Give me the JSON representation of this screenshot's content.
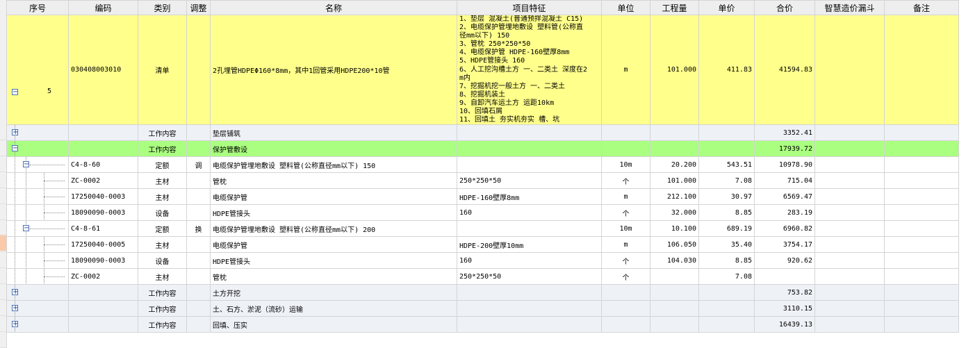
{
  "columns": {
    "seq": "序号",
    "code": "编码",
    "type": "类别",
    "adjust": "调整",
    "name": "名称",
    "features": "项目特征",
    "unit": "单位",
    "qty": "工程量",
    "price": "单价",
    "total": "合价",
    "smart": "智慧造价漏斗",
    "note": "备注"
  },
  "bill": {
    "seq": "5",
    "code": "030408003010",
    "type": "清单",
    "name": "2孔埋管HDPEΦ160*8mm，其中1回管采用HDPE200*10管",
    "features": [
      "1、垫层 混凝土(普通预拌混凝土 C15)",
      "2、电缆保护管埋地敷设 塑料管(公称直",
      "径mm以下) 150",
      "3、管枕 250*250*50",
      "4、电缆保护管 HDPE-160壁厚8mm",
      "5、HDPE管接头 160",
      "6、人工挖沟槽土方 一、二类土 深度在2",
      "m内",
      "7、挖掘机挖一般土方 一、二类土",
      "8、挖掘机装土",
      "9、自卸汽车运土方 运距10km",
      "10、回填石屑",
      "11、回填土 夯实机夯实 槽、坑"
    ],
    "unit": "m",
    "qty": "101.000",
    "price": "411.83",
    "total": "41594.83"
  },
  "rows": [
    {
      "kind": "gz",
      "code": "",
      "type": "工作内容",
      "adjust": "",
      "name": "垫层铺筑",
      "features": "",
      "unit": "",
      "qty": "",
      "price": "",
      "total": "3352.41",
      "toggle": "+"
    },
    {
      "kind": "hl",
      "code": "",
      "type": "工作内容",
      "adjust": "",
      "name": "保护管敷设",
      "features": "",
      "unit": "",
      "qty": "",
      "price": "",
      "total": "17939.72",
      "toggle": "−"
    },
    {
      "kind": "de",
      "code": "C4-8-60",
      "type": "定额",
      "adjust": "调",
      "name": "电缆保护管埋地敷设 塑料管(公称直径mm以下) 150",
      "features": "",
      "unit": "10m",
      "qty": "20.200",
      "price": "543.51",
      "total": "10978.90",
      "toggle": "−"
    },
    {
      "kind": "mt",
      "code": "ZC-0002",
      "type": "主材",
      "adjust": "",
      "name": "管枕",
      "features": "250*250*50",
      "unit": "个",
      "qty": "101.000",
      "price": "7.08",
      "total": "715.04"
    },
    {
      "kind": "mt",
      "code": "17250040-0003",
      "type": "主材",
      "adjust": "",
      "name": "电缆保护管",
      "features": "HDPE-160壁厚8mm",
      "unit": "m",
      "qty": "212.100",
      "price": "30.97",
      "total": "6569.47"
    },
    {
      "kind": "mt",
      "code": "18090090-0003",
      "type": "设备",
      "adjust": "",
      "name": "HDPE管接头",
      "features": "160",
      "unit": "个",
      "qty": "32.000",
      "price": "8.85",
      "total": "283.19"
    },
    {
      "kind": "sel",
      "code": "C4-8-61",
      "type": "定额",
      "adjust": "换",
      "name": "电缆保护管埋地敷设 塑料管(公称直径mm以下) 200",
      "features": "",
      "unit": "10m",
      "qty": "10.100",
      "price": "689.19",
      "total": "6960.82",
      "toggle": "−"
    },
    {
      "kind": "mt",
      "code": "17250040-0005",
      "type": "主材",
      "adjust": "",
      "name": "电缆保护管",
      "features": "HDPE-200壁厚10mm",
      "unit": "m",
      "qty": "106.050",
      "price": "35.40",
      "total": "3754.17"
    },
    {
      "kind": "mt",
      "code": "18090090-0003",
      "type": "设备",
      "adjust": "",
      "name": "HDPE管接头",
      "features": "160",
      "unit": "个",
      "qty": "104.030",
      "price": "8.85",
      "total": "920.62"
    },
    {
      "kind": "mt",
      "code": "ZC-0002",
      "type": "主材",
      "adjust": "",
      "name": "管枕",
      "features": "250*250*50",
      "unit": "个",
      "qty": "",
      "price": "7.08",
      "total": ""
    },
    {
      "kind": "gz",
      "code": "",
      "type": "工作内容",
      "adjust": "",
      "name": "土方开挖",
      "features": "",
      "unit": "",
      "qty": "",
      "price": "",
      "total": "753.82",
      "toggle": "+"
    },
    {
      "kind": "gz",
      "code": "",
      "type": "工作内容",
      "adjust": "",
      "name": "土、石方、淤泥（流砂）运输",
      "features": "",
      "unit": "",
      "qty": "",
      "price": "",
      "total": "3110.15",
      "toggle": "+"
    },
    {
      "kind": "gz",
      "code": "",
      "type": "工作内容",
      "adjust": "",
      "name": "回填、压实",
      "features": "",
      "unit": "",
      "qty": "",
      "price": "",
      "total": "16439.13",
      "toggle": "+"
    }
  ],
  "icons": {
    "expand": "plus-box-icon",
    "collapse": "minus-box-icon"
  },
  "colors": {
    "bill_row": "#ffff8c",
    "highlight_row": "#aaff80",
    "work_row": "#eef1f6",
    "selection": "#2f7fd8"
  }
}
